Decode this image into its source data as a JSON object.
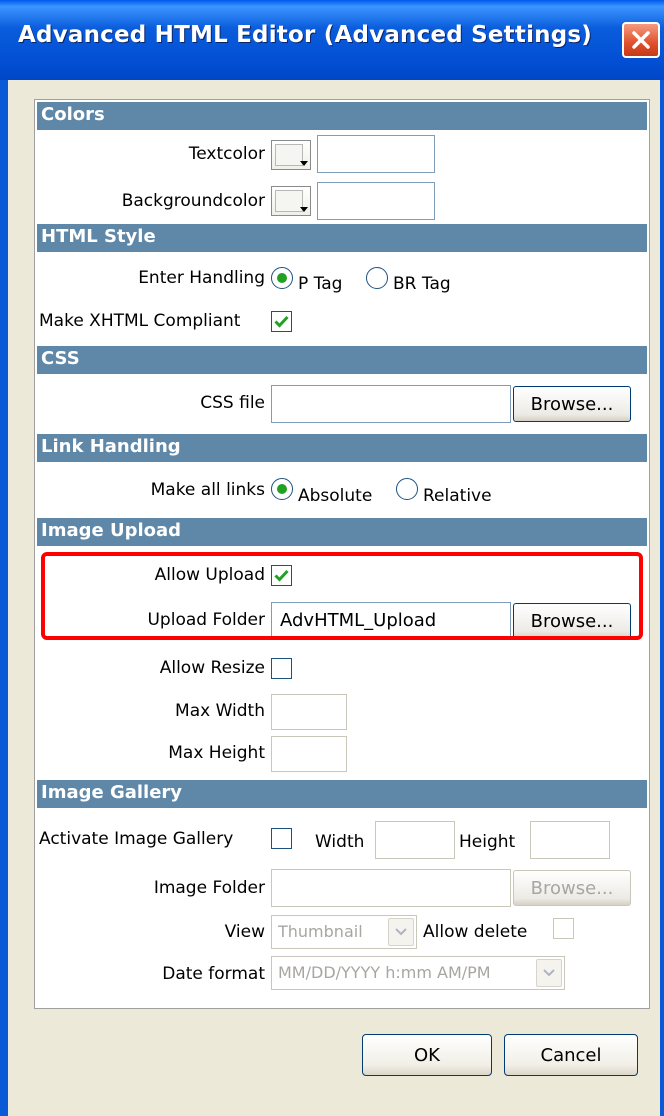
{
  "window": {
    "title": "Advanced HTML Editor (Advanced Settings)"
  },
  "colors": {
    "header": "Colors",
    "textcolor_label": "Textcolor",
    "textcolor_value": "",
    "backgroundcolor_label": "Backgroundcolor",
    "backgroundcolor_value": ""
  },
  "html_style": {
    "header": "HTML Style",
    "enter_handling_label": "Enter Handling",
    "option_p": "P Tag",
    "option_br": "BR Tag",
    "selected": "P Tag",
    "xhtml_label": "Make XHTML Compliant",
    "xhtml_checked": true
  },
  "css": {
    "header": "CSS",
    "file_label": "CSS file",
    "file_value": "",
    "browse_label": "Browse..."
  },
  "link_handling": {
    "header": "Link Handling",
    "label": "Make all links",
    "option_absolute": "Absolute",
    "option_relative": "Relative",
    "selected": "Absolute"
  },
  "image_upload": {
    "header": "Image Upload",
    "allow_upload_label": "Allow Upload",
    "allow_upload_checked": true,
    "upload_folder_label": "Upload Folder",
    "upload_folder_value": "AdvHTML_Upload",
    "browse_label": "Browse...",
    "allow_resize_label": "Allow Resize",
    "allow_resize_checked": false,
    "max_width_label": "Max Width",
    "max_width_value": "",
    "max_height_label": "Max Height",
    "max_height_value": ""
  },
  "image_gallery": {
    "header": "Image Gallery",
    "activate_label": "Activate Image Gallery",
    "activate_checked": false,
    "width_label": "Width",
    "width_value": "",
    "height_label": "Height",
    "height_value": "",
    "folder_label": "Image Folder",
    "folder_value": "",
    "browse_label": "Browse...",
    "view_label": "View",
    "view_value": "Thumbnail",
    "allow_delete_label": "Allow delete",
    "allow_delete_checked": false,
    "date_format_label": "Date format",
    "date_format_value": "MM/DD/YYYY h:mm AM/PM"
  },
  "buttons": {
    "ok": "OK",
    "cancel": "Cancel"
  },
  "theme": {
    "title_bar": "#0a5ddc",
    "dialog_face": "#ece9d8",
    "section_header": "#5f88a8",
    "check_color": "#21a121",
    "highlight": "#ff0000"
  }
}
